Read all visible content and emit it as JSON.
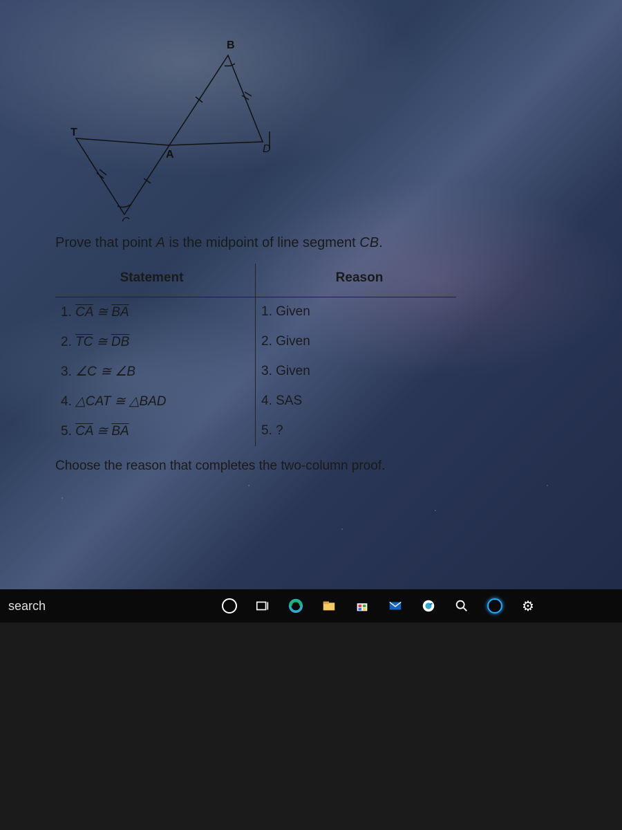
{
  "diagram": {
    "labels": {
      "T": "T",
      "B": "B",
      "A": "A",
      "C": "C",
      "D": "D"
    }
  },
  "prompt": {
    "pre": "Prove that point ",
    "pointA": "A",
    "mid": " is the midpoint of line segment ",
    "seg": "CB",
    "post": "."
  },
  "table": {
    "hStatement": "Statement",
    "hReason": "Reason",
    "rows": [
      {
        "n": "1.",
        "stmt_a": "CA",
        "op": "≅",
        "stmt_b": "BA",
        "ov": true,
        "reason": "1. Given"
      },
      {
        "n": "2.",
        "stmt_a": "TC",
        "op": "≅",
        "stmt_b": "DB",
        "ov": true,
        "reason": "2. Given"
      },
      {
        "n": "3.",
        "stmt_a": "∠C",
        "op": "≅",
        "stmt_b": "∠B",
        "ov": false,
        "reason": "3. Given"
      },
      {
        "n": "4.",
        "stmt_a": "△CAT",
        "op": "≅",
        "stmt_b": "△BAD",
        "ov": false,
        "reason": "4. SAS"
      },
      {
        "n": "5.",
        "stmt_a": "CA",
        "op": "≅",
        "stmt_b": "BA",
        "ov": true,
        "reason": "5. ?"
      }
    ]
  },
  "question": "Choose the reason that completes the two-column proof.",
  "taskbar": {
    "search": "search"
  }
}
